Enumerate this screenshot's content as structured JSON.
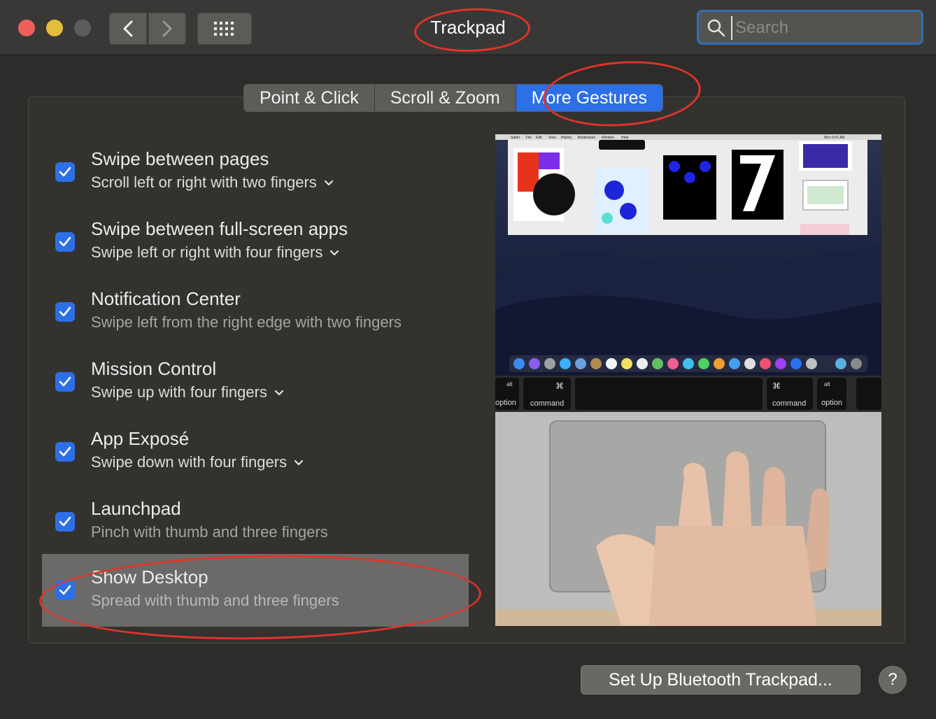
{
  "window": {
    "title": "Trackpad",
    "search_placeholder": "Search"
  },
  "tabs": [
    {
      "label": "Point & Click",
      "active": false
    },
    {
      "label": "Scroll & Zoom",
      "active": false
    },
    {
      "label": "More Gestures",
      "active": true
    }
  ],
  "gestures": [
    {
      "title": "Swipe between pages",
      "description": "Scroll left or right with two fingers",
      "has_menu": true,
      "checked": true
    },
    {
      "title": "Swipe between full-screen apps",
      "description": "Swipe left or right with four fingers",
      "has_menu": true,
      "checked": true
    },
    {
      "title": "Notification Center",
      "description": "Swipe left from the right edge with two fingers",
      "has_menu": false,
      "checked": true
    },
    {
      "title": "Mission Control",
      "description": "Swipe up with four fingers",
      "has_menu": true,
      "checked": true
    },
    {
      "title": "App Exposé",
      "description": "Swipe down with four fingers",
      "has_menu": true,
      "checked": true
    },
    {
      "title": "Launchpad",
      "description": "Pinch with thumb and three fingers",
      "has_menu": false,
      "checked": true
    },
    {
      "title": "Show Desktop",
      "description": "Spread with thumb and three fingers",
      "has_menu": false,
      "checked": true,
      "selected": true
    }
  ],
  "preview": {
    "menubar_items": [
      "Safari",
      "File",
      "Edit",
      "View",
      "History",
      "Bookmarks",
      "Window",
      "Help"
    ],
    "menubar_time": "Mon 9:41 AM",
    "keys": {
      "left_option_symbol": "alt",
      "left_option": "option",
      "left_command_symbol": "⌘",
      "left_command": "command",
      "right_command_symbol": "⌘",
      "right_command": "command",
      "right_option_symbol": "alt",
      "right_option": "option"
    }
  },
  "buttons": {
    "setup": "Set Up Bluetooth Trackpad...",
    "help": "?"
  },
  "colors": {
    "accent": "#2d6fe6",
    "annotation": "#e0342a"
  }
}
